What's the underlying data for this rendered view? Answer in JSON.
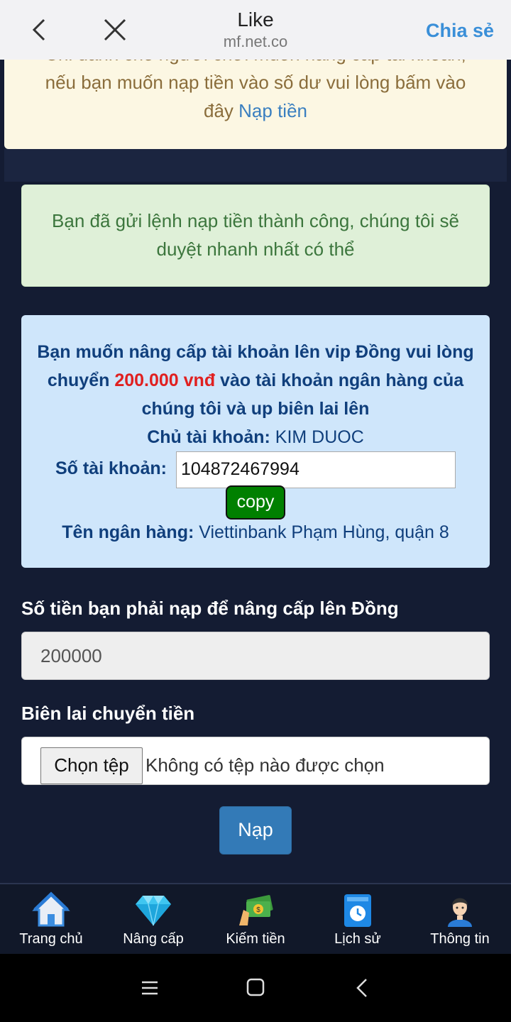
{
  "browser": {
    "title": "Like",
    "url": "mf.net.co",
    "share_label": "Chia sẻ"
  },
  "warning": {
    "line1": "Chỉ dành cho người chơi muốn nâng cấp tài khoản,",
    "line2": "nếu bạn muốn nạp tiền vào số dư vui lòng bấm vào",
    "line3_prefix": "đây ",
    "link_label": "Nạp tiền"
  },
  "success_message": "Bạn đã gửi lệnh nạp tiền thành công, chúng tôi sẽ duyệt nhanh nhất có thể",
  "info": {
    "msg_prefix": "Bạn muốn nâng cấp tài khoản lên vip Đồng vui lòng chuyển ",
    "amount": "200.000 vnđ",
    "msg_suffix": " vào tài khoản ngân hàng của chúng tôi và up biên lai lên",
    "owner_label": "Chủ tài khoản:",
    "owner_value": " KIM DUOC",
    "account_label": "Số tài khoản:",
    "account_value": "104872467994",
    "copy_label": "copy",
    "bank_label": "Tên ngân hàng:",
    "bank_value": " Viettinbank Phạm Hùng, quận 8"
  },
  "form": {
    "amount_label": "Số tiền bạn phải nạp để nâng cấp lên Đồng",
    "amount_value": "200000",
    "receipt_label": "Biên lai chuyển tiền",
    "file_button": "Chọn tệp",
    "file_status": "Không có tệp nào được chọn",
    "submit_label": "Nạp"
  },
  "bottom_nav": [
    {
      "label": "Trang chủ",
      "icon": "home-icon"
    },
    {
      "label": "Nâng cấp",
      "icon": "diamond-icon"
    },
    {
      "label": "Kiếm tiền",
      "icon": "money-icon"
    },
    {
      "label": "Lịch sử",
      "icon": "history-icon"
    },
    {
      "label": "Thông tin",
      "icon": "user-icon"
    }
  ],
  "colors": {
    "background": "#141c33",
    "success_bg": "#dff0d8",
    "info_bg": "#cfe6fb",
    "amount_red": "#e02020",
    "primary_button": "#337ab7",
    "copy_button": "#008000"
  }
}
